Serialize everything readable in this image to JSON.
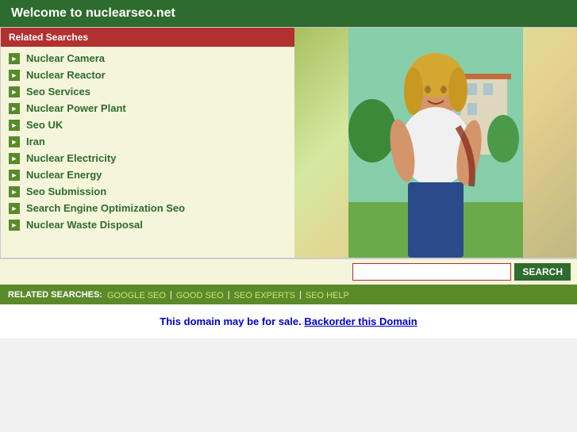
{
  "header": {
    "title": "Welcome to nuclearseo.net"
  },
  "related_searches_header": "Related Searches",
  "search_items": [
    {
      "label": "Nuclear Camera"
    },
    {
      "label": "Nuclear Reactor"
    },
    {
      "label": "Seo Services"
    },
    {
      "label": "Nuclear Power Plant"
    },
    {
      "label": "Seo UK"
    },
    {
      "label": "Iran"
    },
    {
      "label": "Nuclear Electricity"
    },
    {
      "label": "Nuclear Energy"
    },
    {
      "label": "Seo Submission"
    },
    {
      "label": "Search Engine Optimization Seo"
    },
    {
      "label": "Nuclear Waste Disposal"
    }
  ],
  "search_bar": {
    "placeholder": "",
    "button_label": "SEARCH"
  },
  "footer": {
    "label": "RELATED SEARCHES:",
    "links": [
      {
        "label": "GOOGLE SEO"
      },
      {
        "label": "GOOD SEO"
      },
      {
        "label": "SEO EXPERTS"
      },
      {
        "label": "SEO HELP"
      }
    ]
  },
  "domain_notice": {
    "text": "This domain may be for sale.",
    "link_text": "Backorder this Domain",
    "link_href": "#"
  },
  "colors": {
    "header_bg": "#2e6b2e",
    "related_header_bg": "#b33030",
    "bullet_bg": "#5a8a2a",
    "footer_bg": "#5a8a2a",
    "list_bg": "#f5f5dc",
    "link_color": "#2e6b2e"
  }
}
